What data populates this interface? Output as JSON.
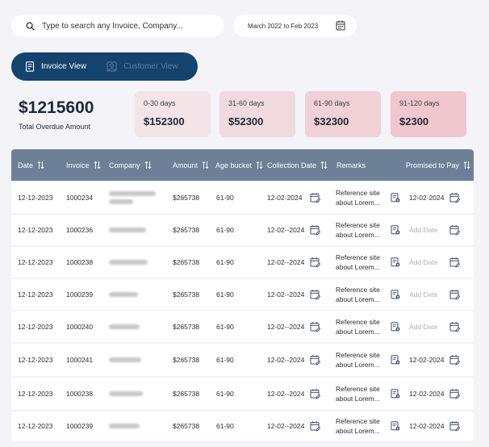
{
  "search": {
    "placeholder": "Type to search any Invoice, Company..."
  },
  "date_range": {
    "value": "March 2022 to Feb 2023"
  },
  "view_toggle": {
    "invoice_label": "Invoice View",
    "customer_label": "Customer View"
  },
  "summary": {
    "total_amount": "$1215600",
    "total_label": "Total Overdue Amount"
  },
  "buckets": [
    {
      "label": "0-30 days",
      "value": "$152300",
      "color": "#f3e4e8"
    },
    {
      "label": "31-60 days",
      "value": "$52300",
      "color": "#f0dade"
    },
    {
      "label": "61-90 days",
      "value": "$32300",
      "color": "#efd1d6"
    },
    {
      "label": "91-120 days",
      "value": "$2300",
      "color": "#efc7cd"
    }
  ],
  "table": {
    "headers": [
      "Date",
      "Invoice",
      "Company",
      "Amount",
      "Age bucket",
      "Collection Date",
      "Remarks",
      "Promised to Pay"
    ],
    "add_date_label": "Add Date",
    "rows": [
      {
        "date": "12-12-2023",
        "invoice": "1000234",
        "amount": "$265738",
        "age": "61-90",
        "collection": "12-02-2024",
        "remark1": "Reference site",
        "remark2": "about Lorem...",
        "promised": "12-02-2024"
      },
      {
        "date": "12-12-2023",
        "invoice": "1000236",
        "amount": "$265738",
        "age": "61-90",
        "collection": "12-02--2024",
        "remark1": "Reference site",
        "remark2": "about Lorem...",
        "promised": ""
      },
      {
        "date": "12-12-2023",
        "invoice": "1000238",
        "amount": "$265738",
        "age": "61-90",
        "collection": "12-02--2024",
        "remark1": "Reference site",
        "remark2": "about Lorem...",
        "promised": ""
      },
      {
        "date": "12-12-2023",
        "invoice": "1000239",
        "amount": "$265738",
        "age": "61-90",
        "collection": "12-02--2024",
        "remark1": "Reference site",
        "remark2": "about Lorem...",
        "promised": ""
      },
      {
        "date": "12-12-2023",
        "invoice": "1000240",
        "amount": "$265738",
        "age": "61-90",
        "collection": "12-02--2024",
        "remark1": "Reference site",
        "remark2": "about Lorem...",
        "promised": ""
      },
      {
        "date": "12-12-2023",
        "invoice": "1000241",
        "amount": "$265738",
        "age": "61-90",
        "collection": "12-02--2024",
        "remark1": "Reference site",
        "remark2": "about Lorem...",
        "promised": "12-02-2024"
      },
      {
        "date": "12-12-2023",
        "invoice": "1000238",
        "amount": "$265738",
        "age": "61-90",
        "collection": "12-02--2024",
        "remark1": "Reference site",
        "remark2": "about Lorem...",
        "promised": "12-02-2024"
      },
      {
        "date": "12-12-2023",
        "invoice": "1000239",
        "amount": "$265738",
        "age": "61-90",
        "collection": "12-02--2024",
        "remark1": "Reference site",
        "remark2": "about Lorem...",
        "promised": "12-02-2024"
      }
    ]
  },
  "colors": {
    "accent": "#14436e",
    "header": "#6d8098",
    "icon": "#3b4f6b",
    "background": "#f3f3f8"
  },
  "icons": {
    "search": "search-icon",
    "calendar": "calendar-icon",
    "invoice": "invoice-icon",
    "customer": "customer-icon",
    "sort": "sort-icon",
    "edit_calendar": "edit-calendar-icon",
    "remark": "remark-edit-icon"
  }
}
